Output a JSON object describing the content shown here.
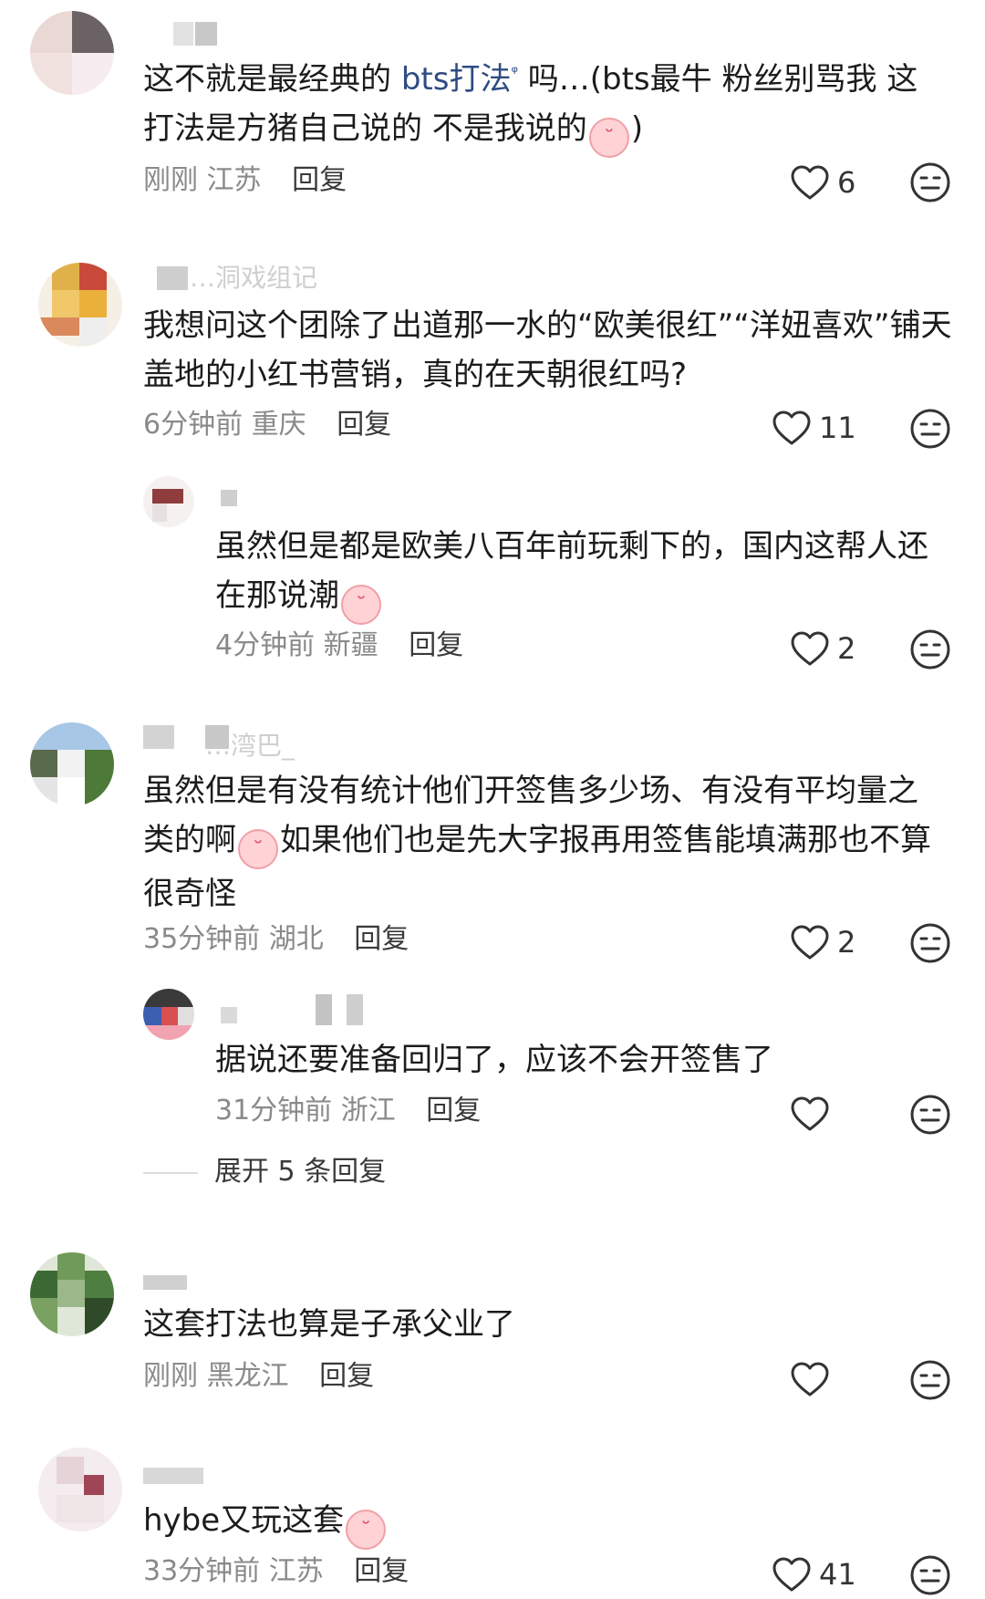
{
  "comments": [
    {
      "username": "",
      "text_parts": [
        "这不就是最经典的 ",
        "bts打法",
        "ᵠ",
        " 吗…(bts最牛 粉丝别骂我 这",
        "打法是方猪自己说的 不是我说的",
        ")"
      ],
      "time": "刚刚",
      "location": "江苏",
      "reply_label": "回复",
      "likes": "6"
    },
    {
      "username_ghost": "…洞戏组记",
      "text": "我想问这个团除了出道那一水的“欧美很红”“洋妞喜欢”铺天盖地的小红书营销，真的在天朝很红吗?",
      "time": "6分钟前",
      "location": "重庆",
      "reply_label": "回复",
      "likes": "11",
      "replies": [
        {
          "text_line1": "虽然但是都是欧美八百年前玩剩下的，国内这帮人还",
          "text_line2": "在那说潮",
          "time": "4分钟前",
          "location": "新疆",
          "reply_label": "回复",
          "likes": "2"
        }
      ]
    },
    {
      "username_ghost": "…湾巴_",
      "text_line1": "虽然但是有没有统计他们开签售多少场、有没有平均量之",
      "text_line2a": "类的啊",
      "text_line2b": "如果他们也是先大字报再用签售能填满那也不算",
      "text_line3": "很奇怪",
      "time": "35分钟前",
      "location": "湖北",
      "reply_label": "回复",
      "likes": "2",
      "replies": [
        {
          "text": "据说还要准备回归了，应该不会开签售了",
          "time": "31分钟前",
          "location": "浙江",
          "reply_label": "回复",
          "likes": ""
        }
      ],
      "expand_label": "展开 5 条回复"
    },
    {
      "text": "这套打法也算是子承父业了",
      "time": "刚刚",
      "location": "黑龙江",
      "reply_label": "回复",
      "likes": ""
    },
    {
      "text": "hybe又玩这套",
      "time": "33分钟前",
      "location": "江苏",
      "reply_label": "回复",
      "likes": "41"
    }
  ],
  "icons": {
    "like": "heart-outline-icon",
    "dislike": "neutral-face-icon",
    "emoji": "crying-face-emoji"
  },
  "colors": {
    "text": "#1c1c1c",
    "meta": "#8a8a8a",
    "link": "#2f4c82"
  }
}
